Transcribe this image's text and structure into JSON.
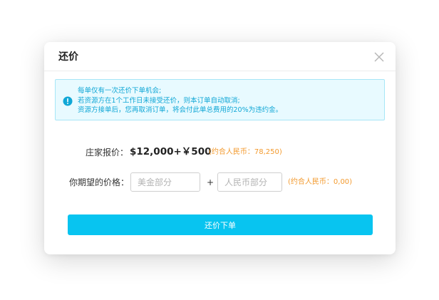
{
  "dialog": {
    "title": "还价",
    "close_icon": "close-icon"
  },
  "notice": {
    "icon": "exclamation-circle-icon",
    "lines": [
      "每单仅有一次还价下单机会;",
      "若资源方在1个工作日未接受还价，则本订单自动取消;",
      "资源方接单后，您再取消订单，将会付此单总费用的20%为违约金。"
    ]
  },
  "offer": {
    "label": "庄家报价：",
    "price": "$12,000+￥500",
    "rmb_hint": "(约合人民币：78,250)"
  },
  "counter": {
    "label": "你期望的价格：",
    "usd_placeholder": "美金部分",
    "usd_value": "",
    "plus": "+",
    "rmb_placeholder": "人民币部分",
    "rmb_value": "",
    "rmb_hint": "(约合人民币：0,00)"
  },
  "submit_label": "还价下单",
  "colors": {
    "accent": "#08c4f0",
    "notice_bg": "#e8faff",
    "notice_border": "#a7e6f7",
    "notice_text": "#10a7d6",
    "hint": "#f39a2e"
  }
}
